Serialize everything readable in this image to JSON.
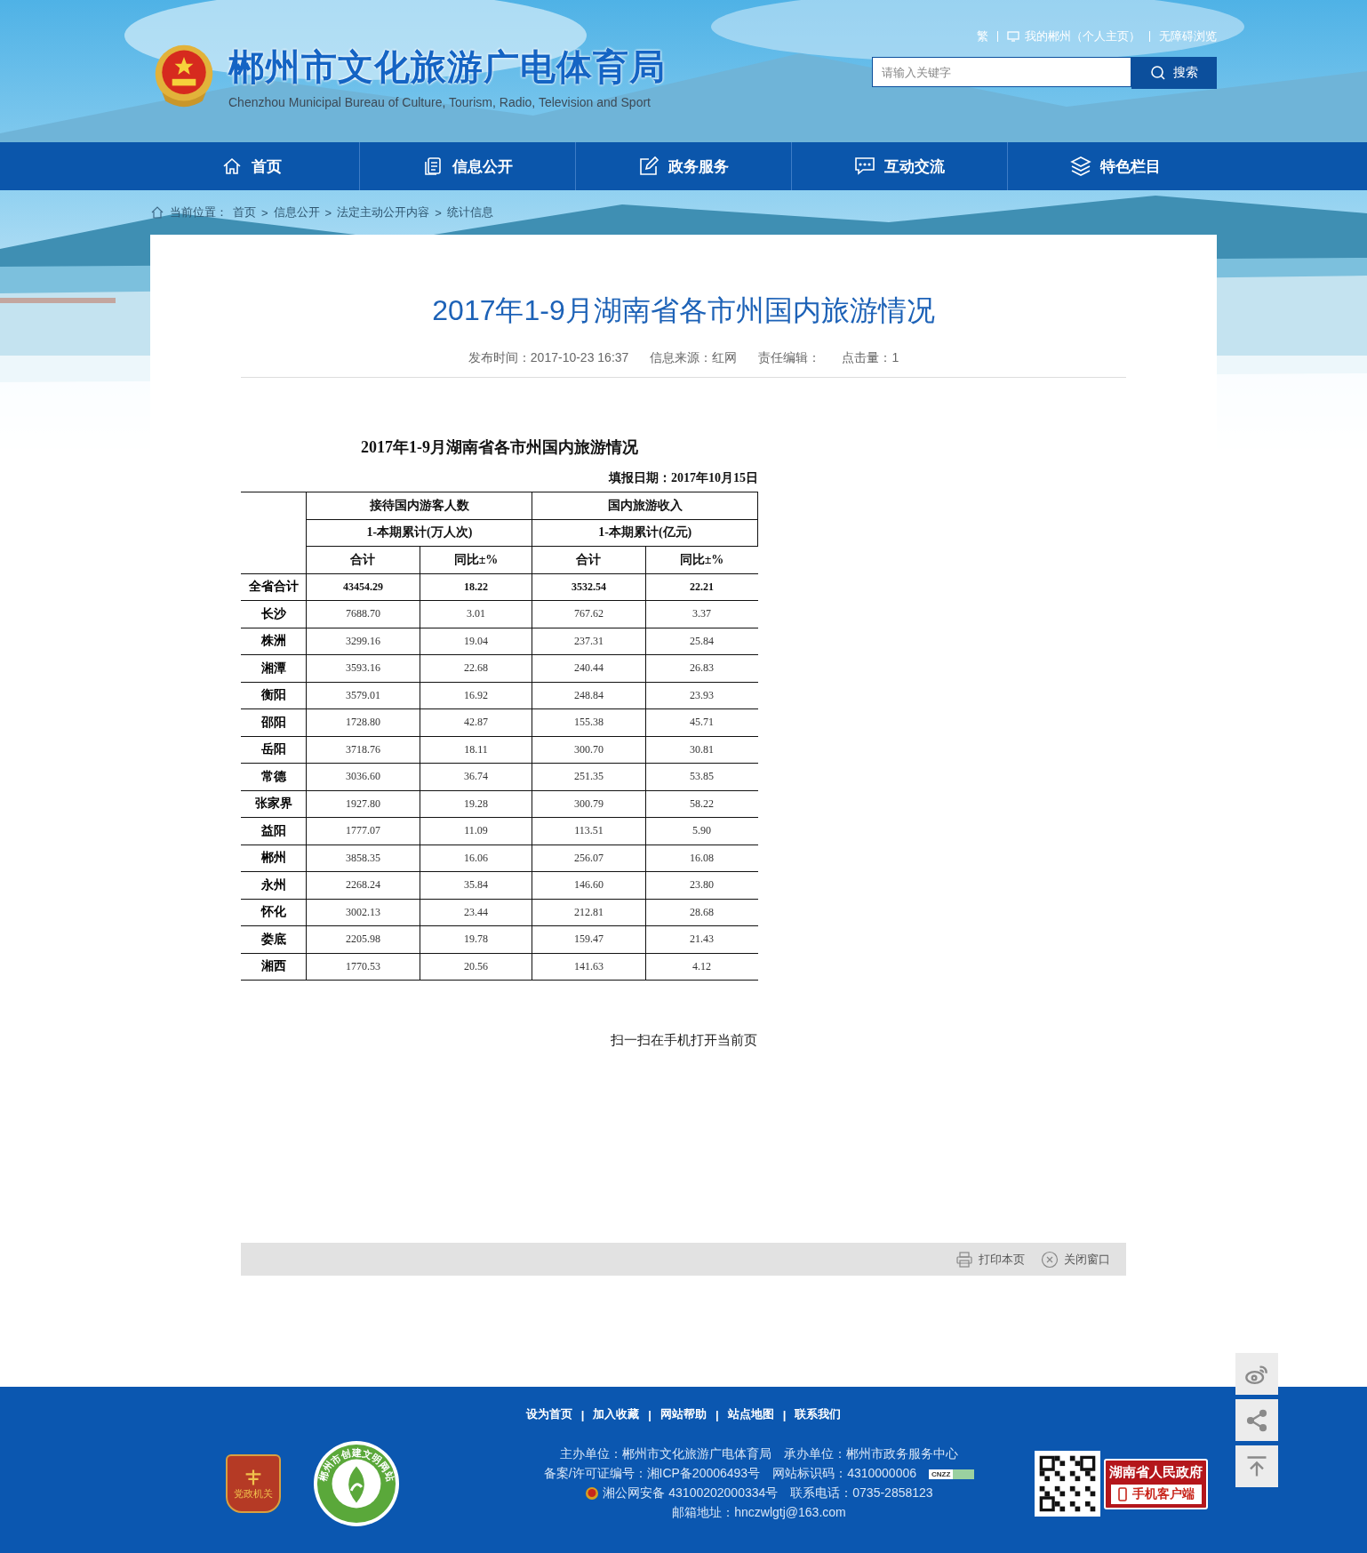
{
  "header": {
    "title": "郴州市文化旅游广电体育局",
    "subtitle": "Chenzhou Municipal Bureau of Culture, Tourism, Radio, Television and Sport",
    "top_links": [
      {
        "kind": "text",
        "label": "繁"
      },
      {
        "kind": "monitor",
        "label": "我的郴州（个人主页）"
      },
      {
        "kind": "text",
        "label": "无障碍浏览"
      }
    ],
    "search": {
      "placeholder": "请输入关键字",
      "button": "搜索"
    }
  },
  "nav": [
    {
      "label": "首页"
    },
    {
      "label": "信息公开"
    },
    {
      "label": "政务服务"
    },
    {
      "label": "互动交流"
    },
    {
      "label": "特色栏目"
    }
  ],
  "breadcrumb": {
    "label": "当前位置：",
    "separator": ">",
    "items": [
      "首页",
      "信息公开",
      "法定主动公开内容",
      "统计信息"
    ]
  },
  "article": {
    "title": "2017年1-9月湖南省各市州国内旅游情况",
    "meta": [
      "发布时间：2017-10-23 16:37",
      "信息来源：红网",
      "责任编辑：",
      "点击量：1"
    ]
  },
  "table": {
    "title": "2017年1-9月湖南省各市州国内旅游情况",
    "report_date": "填报日期：2017年10月15日",
    "groups": [
      "接待国内游客人数",
      "国内旅游收入"
    ],
    "units": [
      "1-本期累计(万人次)",
      "1-本期累计(亿元)"
    ],
    "columns": [
      "合计",
      "同比±%",
      "合计",
      "同比±%"
    ],
    "rows": [
      {
        "kind": "total",
        "name": "全省合计",
        "values": [
          "43454.29",
          "18.22",
          "3532.54",
          "22.21"
        ]
      },
      {
        "kind": "city",
        "name": "长沙",
        "values": [
          "7688.70",
          "3.01",
          "767.62",
          "3.37"
        ]
      },
      {
        "kind": "city",
        "name": "株洲",
        "values": [
          "3299.16",
          "19.04",
          "237.31",
          "25.84"
        ]
      },
      {
        "kind": "city",
        "name": "湘潭",
        "values": [
          "3593.16",
          "22.68",
          "240.44",
          "26.83"
        ]
      },
      {
        "kind": "city",
        "name": "衡阳",
        "values": [
          "3579.01",
          "16.92",
          "248.84",
          "23.93"
        ]
      },
      {
        "kind": "city",
        "name": "邵阳",
        "values": [
          "1728.80",
          "42.87",
          "155.38",
          "45.71"
        ]
      },
      {
        "kind": "city",
        "name": "岳阳",
        "values": [
          "3718.76",
          "18.11",
          "300.70",
          "30.81"
        ]
      },
      {
        "kind": "city",
        "name": "常德",
        "values": [
          "3036.60",
          "36.74",
          "251.35",
          "53.85"
        ]
      },
      {
        "kind": "city",
        "name": "张家界",
        "values": [
          "1927.80",
          "19.28",
          "300.79",
          "58.22"
        ]
      },
      {
        "kind": "city",
        "name": "益阳",
        "values": [
          "1777.07",
          "11.09",
          "113.51",
          "5.90"
        ]
      },
      {
        "kind": "city",
        "name": "郴州",
        "values": [
          "3858.35",
          "16.06",
          "256.07",
          "16.08"
        ]
      },
      {
        "kind": "city",
        "name": "永州",
        "values": [
          "2268.24",
          "35.84",
          "146.60",
          "23.80"
        ]
      },
      {
        "kind": "city",
        "name": "怀化",
        "values": [
          "3002.13",
          "23.44",
          "212.81",
          "28.68"
        ]
      },
      {
        "kind": "city",
        "name": "娄底",
        "values": [
          "2205.98",
          "19.78",
          "159.47",
          "21.43"
        ]
      },
      {
        "kind": "city",
        "name": "湘西",
        "values": [
          "1770.53",
          "20.56",
          "141.63",
          "4.12"
        ]
      }
    ]
  },
  "qr_hint": "扫一扫在手机打开当前页",
  "tools": [
    {
      "label": "打印本页"
    },
    {
      "label": "关闭窗口"
    }
  ],
  "footer": {
    "links": [
      "设为首页",
      "加入收藏",
      "网站帮助",
      "站点地图",
      "联系我们"
    ],
    "separator": "|",
    "badge_party": "党政机关",
    "badge_civil": "郴州市创建文明网站",
    "lines": [
      [
        {
          "kind": "text",
          "text": "主办单位：郴州市文化旅游广电体育局"
        },
        {
          "kind": "text",
          "text": "承办单位：郴州市政务服务中心"
        }
      ],
      [
        {
          "kind": "text",
          "text": "备案/许可证编号：湘ICP备20006493号"
        },
        {
          "kind": "text",
          "text": "网站标识码：4310000006"
        },
        {
          "kind": "cnzz",
          "text": "CNZZ"
        }
      ],
      [
        {
          "kind": "police",
          "text": "湘公网安备 43100202000334号"
        },
        {
          "kind": "text",
          "text": "联系电话：0735-2858123"
        }
      ],
      [
        {
          "kind": "text",
          "text": "邮箱地址：hnczwlgtj@163.com"
        }
      ]
    ],
    "app_badge": [
      "湖南省人民政府",
      "手机客户端"
    ]
  }
}
